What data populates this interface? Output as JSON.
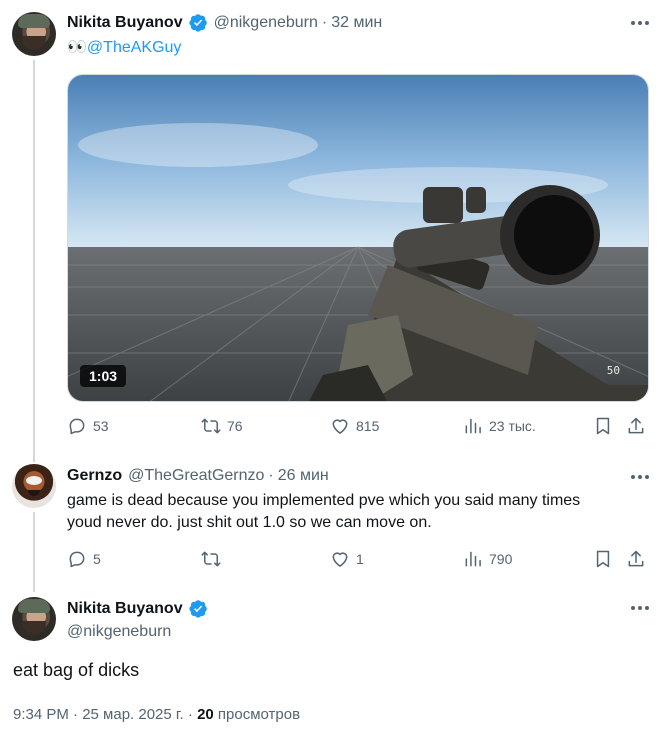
{
  "tweet1": {
    "display_name": "Nikita Buyanov",
    "handle": "@nikgeneburn",
    "separator": "·",
    "time": "32 мин",
    "text_emoji": "👀",
    "mention": "@TheAKGuy",
    "video_duration": "1:03",
    "video_overlay_fps": "50",
    "stats": {
      "replies": "53",
      "reposts": "76",
      "likes": "815",
      "views": "23 тыс."
    }
  },
  "tweet2": {
    "display_name": "Gernzo",
    "handle": "@TheGreatGernzo",
    "separator": "·",
    "time": "26 мин",
    "text_line1": "game is dead because you implemented pve which you said many times",
    "text_line2": "youd never do. just shit out 1.0 so we can move on.",
    "stats": {
      "replies": "5",
      "reposts": "",
      "likes": "1",
      "views": "790"
    }
  },
  "main_tweet": {
    "display_name": "Nikita Buyanov",
    "handle": "@nikgeneburn",
    "text": "eat bag of dicks",
    "timestamp": "9:34 PM · 25 мар. 2025 г. ·",
    "views_count": "20",
    "views_label": "просмотров"
  },
  "colors": {
    "verified": "#1d9bf0",
    "accent": "#1d9bf0",
    "muted": "#536471",
    "text": "#0f1419",
    "line": "#cfd9de"
  },
  "icons": [
    "verified-badge-icon",
    "more-icon",
    "reply-icon",
    "repost-icon",
    "like-icon",
    "views-icon",
    "bookmark-icon",
    "share-icon"
  ]
}
